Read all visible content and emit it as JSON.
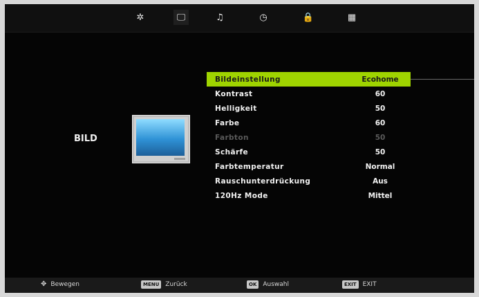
{
  "tabs": [
    {
      "icon": "gear-icon",
      "glyph": "✲"
    },
    {
      "icon": "monitor-icon",
      "glyph": "🖵"
    },
    {
      "icon": "music-note-icon",
      "glyph": "♫"
    },
    {
      "icon": "clock-icon",
      "glyph": "◷"
    },
    {
      "icon": "lock-icon",
      "glyph": "🔒"
    },
    {
      "icon": "grid-icon",
      "glyph": "▦"
    }
  ],
  "section": {
    "label": "BILD"
  },
  "menu": {
    "items": [
      {
        "label": "Bildeinstellung",
        "value": "Ecohome"
      },
      {
        "label": "Kontrast",
        "value": "60"
      },
      {
        "label": "Helligkeit",
        "value": "50"
      },
      {
        "label": "Farbe",
        "value": "60"
      },
      {
        "label": "Farbton",
        "value": "50"
      },
      {
        "label": "Schärfe",
        "value": "50"
      },
      {
        "label": "Farbtemperatur",
        "value": "Normal"
      },
      {
        "label": "Rauschunterdrückung",
        "value": "Aus"
      },
      {
        "label": "120Hz Mode",
        "value": "Mittel"
      }
    ],
    "selected_color": "#9fd400"
  },
  "footer": {
    "move": {
      "label": "Bewegen"
    },
    "back": {
      "key": "MENU",
      "label": "Zurück"
    },
    "select": {
      "key": "OK",
      "label": "Auswahl"
    },
    "exit": {
      "key": "EXIT",
      "label": "EXIT"
    }
  }
}
